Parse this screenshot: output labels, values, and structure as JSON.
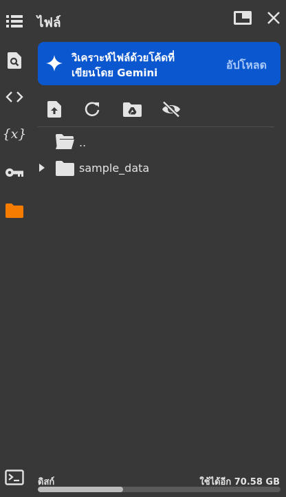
{
  "panel": {
    "title": "ไฟล์"
  },
  "banner": {
    "line1": "วิเคราะห์ไฟล์ด้วยโค้ดที่",
    "line2": "เขียนโดย Gemini",
    "action": "อัปโหลด"
  },
  "rail": {
    "items": [
      {
        "icon": "toc-icon"
      },
      {
        "icon": "search-icon"
      },
      {
        "icon": "code-brackets-icon"
      },
      {
        "icon": "variables-icon",
        "text": "{x}"
      },
      {
        "icon": "key-icon"
      },
      {
        "icon": "folder-icon",
        "active": true
      },
      {
        "icon": "terminal-icon"
      }
    ]
  },
  "toolbar": {
    "items": [
      {
        "icon": "upload-file-icon"
      },
      {
        "icon": "refresh-icon"
      },
      {
        "icon": "drive-folder-icon"
      },
      {
        "icon": "visibility-off-icon"
      }
    ]
  },
  "files": [
    {
      "name": "..",
      "type": "parent-folder"
    },
    {
      "name": "sample_data",
      "type": "folder",
      "expandable": true
    }
  ],
  "disk": {
    "label": "ดิสก์",
    "free_text": "ใช้ได้อีก 70.58 GB",
    "used_fraction": 0.35
  },
  "colors": {
    "background": "#383838",
    "banner": "#0b57d0",
    "accent_folder": "#f57c00",
    "icon": "#e3e3e3"
  }
}
